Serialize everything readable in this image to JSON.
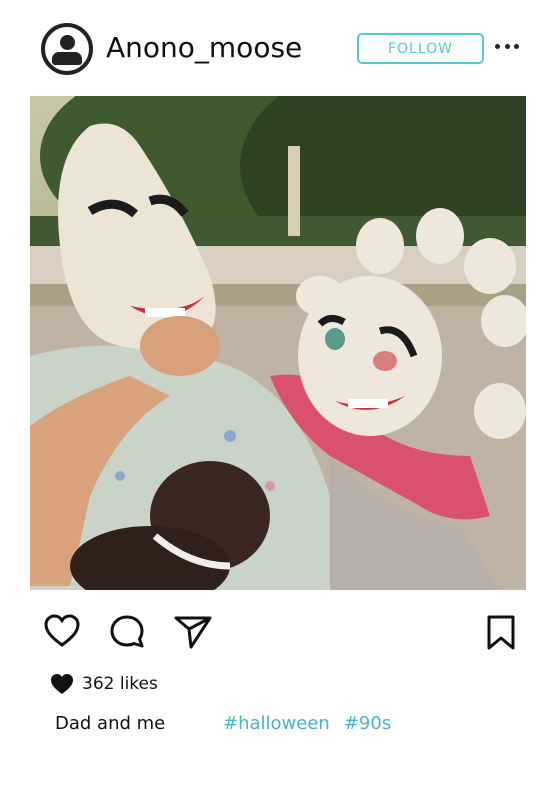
{
  "post": {
    "username": "Anono_moose",
    "follow_label": "FOLLOW",
    "likes": "362 likes",
    "caption": "Dad and me",
    "hashtags": [
      "#halloween",
      "#90s"
    ]
  },
  "icons": {
    "avatar": "user-avatar-icon",
    "more": "more-options-icon",
    "like": "heart-icon",
    "comment": "comment-bubble-icon",
    "share": "send-icon",
    "save": "bookmark-icon"
  },
  "colors": {
    "accent": "#5bc4d6",
    "hashtag": "#4ab3c4",
    "text": "#111111"
  }
}
